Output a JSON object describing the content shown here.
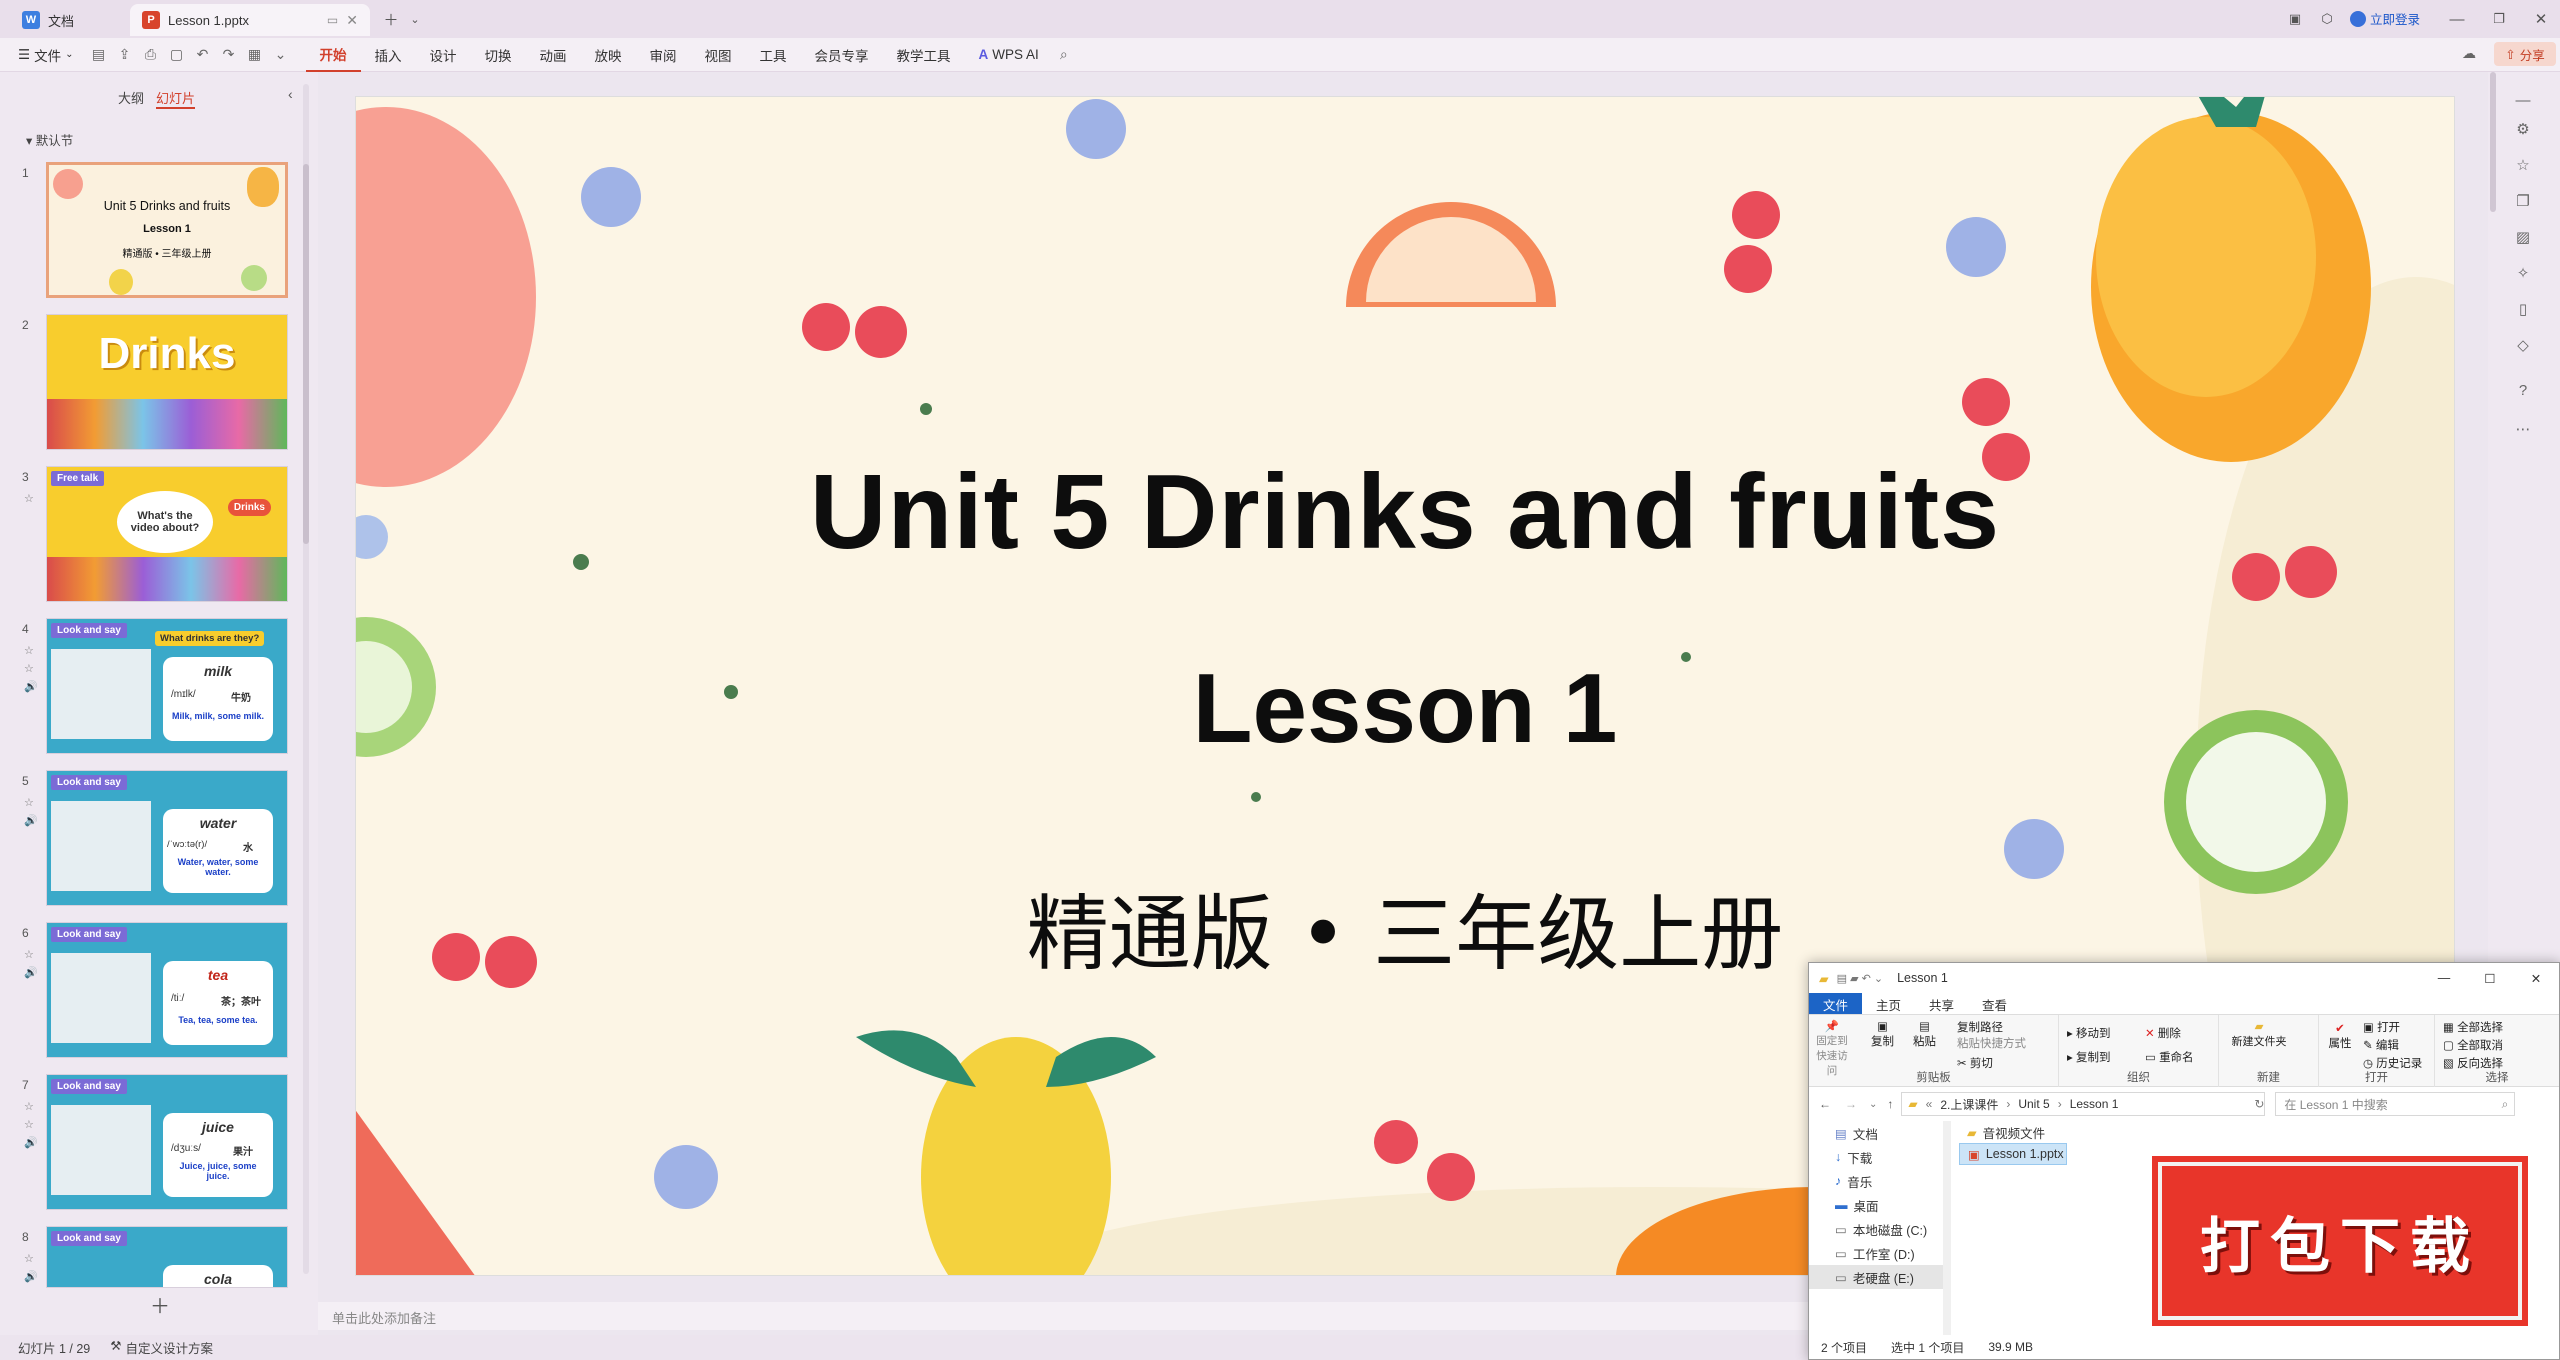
{
  "tabs": [
    {
      "label": "文档",
      "icon": "document-icon"
    },
    {
      "label": "Lesson 1.pptx",
      "icon": "ppt-icon"
    }
  ],
  "window": {
    "login_label": "立即登录",
    "share_label": "分享"
  },
  "menubar": {
    "file_label": "文件",
    "items": [
      "开始",
      "插入",
      "设计",
      "切换",
      "动画",
      "放映",
      "审阅",
      "视图",
      "工具",
      "会员专享",
      "教学工具"
    ],
    "ai_label": "WPS AI"
  },
  "leftpanel": {
    "outline_tab": "大纲",
    "slides_tab": "幻灯片",
    "section": "默认节",
    "slides": [
      {
        "num": "1",
        "title": "Unit 5  Drinks and fruits",
        "sub1": "Lesson 1",
        "sub2": "精通版 • 三年级上册"
      },
      {
        "num": "2",
        "title": "Drinks"
      },
      {
        "num": "3",
        "tag": "Free talk",
        "bubble": "What's the video about?",
        "badge": "Drinks"
      },
      {
        "num": "4",
        "tag": "Look and say",
        "banner": "What drinks are they?",
        "word": "milk",
        "phon": "/mɪlk/",
        "cn": "牛奶",
        "sentence": "Milk, milk, some milk."
      },
      {
        "num": "5",
        "tag": "Look and say",
        "word": "water",
        "phon": "/ˈwɔːtə(r)/",
        "cn": "水",
        "sentence": "Water, water, some water."
      },
      {
        "num": "6",
        "tag": "Look and say",
        "word": "tea",
        "phon": "/tiː/",
        "cn": "茶；茶叶",
        "sentence": "Tea, tea, some tea."
      },
      {
        "num": "7",
        "tag": "Look and say",
        "word": "juice",
        "phon": "/dʒuːs/",
        "cn": "果汁",
        "sentence": "Juice, juice, some juice."
      },
      {
        "num": "8",
        "tag": "Look and say",
        "word": "cola"
      }
    ]
  },
  "slide": {
    "title": "Unit 5  Drinks and fruits",
    "subtitle": "Lesson 1",
    "edition": "精通版 • 三年级上册"
  },
  "notes_placeholder": "单击此处添加备注",
  "status": {
    "slide_count": "幻灯片 1 / 29",
    "design_label": "自定义设计方案"
  },
  "explorer": {
    "title": "Lesson 1",
    "tabs": [
      "文件",
      "主页",
      "共享",
      "查看"
    ],
    "ribbon": {
      "clipboard": {
        "pin": "固定到快速访问",
        "copy": "复制",
        "paste": "粘贴",
        "copy_path": "复制路径",
        "paste_shortcut": "粘贴快捷方式",
        "cut": "剪切",
        "label": "剪贴板"
      },
      "organize": {
        "move_to": "移动到",
        "copy_to": "复制到",
        "delete": "删除",
        "rename": "重命名",
        "label": "组织"
      },
      "new": {
        "new_folder": "新建文件夹",
        "label": "新建"
      },
      "open": {
        "properties": "属性",
        "open": "打开",
        "edit": "编辑",
        "history": "历史记录",
        "label": "打开"
      },
      "select": {
        "select_all": "全部选择",
        "select_none": "全部取消",
        "invert": "反向选择",
        "label": "选择"
      }
    },
    "path": [
      "2.上课课件",
      "Unit 5",
      "Lesson 1"
    ],
    "search_placeholder": "在 Lesson 1 中搜索",
    "nav": [
      "文档",
      "下载",
      "音乐",
      "桌面",
      "本地磁盘 (C:)",
      "工作室 (D:)",
      "老硬盘 (E:)"
    ],
    "files": [
      "音视频文件",
      "Lesson 1.pptx"
    ],
    "status": {
      "count": "2 个项目",
      "selected": "选中 1 个项目",
      "size": "39.9 MB"
    }
  },
  "download_badge": "打包下载",
  "colors": {
    "accent": "#d2402c",
    "selection": "#e9a27b",
    "badge_red": "#e8352a",
    "explorer_blue": "#1c64c6"
  }
}
